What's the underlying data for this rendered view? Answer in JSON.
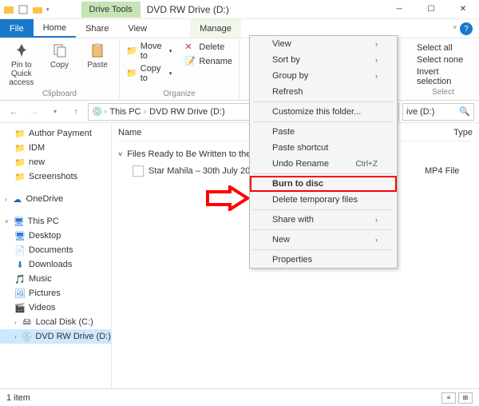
{
  "titlebar": {
    "drive_tools": "Drive Tools",
    "window_title": "DVD RW Drive (D:)"
  },
  "tabs": {
    "file": "File",
    "home": "Home",
    "share": "Share",
    "view": "View",
    "manage": "Manage"
  },
  "ribbon": {
    "clipboard": {
      "pin": "Pin to Quick access",
      "copy": "Copy",
      "paste": "Paste",
      "label": "Clipboard"
    },
    "organize": {
      "move_to": "Move to",
      "copy_to": "Copy to",
      "delete": "Delete",
      "rename": "Rename",
      "label": "Organize"
    },
    "select": {
      "select_all": "Select all",
      "select_none": "Select none",
      "invert": "Invert selection",
      "label": "Select"
    }
  },
  "address": {
    "this_pc": "This PC",
    "location": "DVD RW Drive (D:)",
    "search_placeholder": "ive (D:)"
  },
  "sidebar": {
    "author_payment": "Author Payment",
    "idm": "IDM",
    "new": "new",
    "screenshots": "Screenshots",
    "onedrive": "OneDrive",
    "this_pc": "This PC",
    "desktop": "Desktop",
    "documents": "Documents",
    "downloads": "Downloads",
    "music": "Music",
    "pictures": "Pictures",
    "videos": "Videos",
    "local_disk": "Local Disk (C:)",
    "dvd": "DVD RW Drive (D:)"
  },
  "content": {
    "col_name": "Name",
    "col_type": "Type",
    "group_header": "Files Ready to Be Written to the Disc",
    "file_name": "Star Mahila – 30th July 20",
    "file_type": "MP4 File"
  },
  "context_menu": {
    "view": "View",
    "sort_by": "Sort by",
    "group_by": "Group by",
    "refresh": "Refresh",
    "customize": "Customize this folder...",
    "paste": "Paste",
    "paste_shortcut": "Paste shortcut",
    "undo_rename": "Undo Rename",
    "undo_shortcut": "Ctrl+Z",
    "burn": "Burn to disc",
    "delete_temp": "Delete temporary files",
    "share_with": "Share with",
    "new": "New",
    "properties": "Properties"
  },
  "statusbar": {
    "count": "1 item"
  }
}
